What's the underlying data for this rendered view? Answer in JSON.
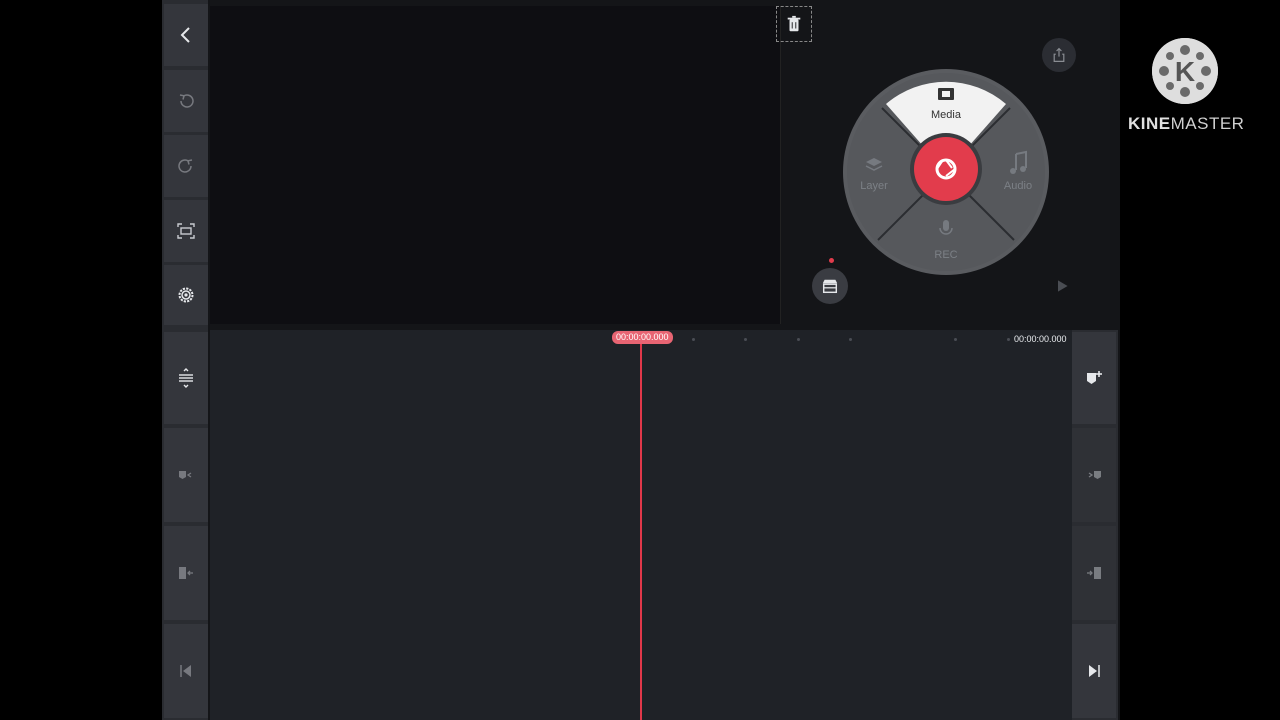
{
  "wheel": {
    "media_label": "Media",
    "layer_label": "Layer",
    "audio_label": "Audio",
    "rec_label": "REC"
  },
  "timeline": {
    "current_time": "00:00:00.000",
    "total_time": "00:00:00.000"
  },
  "logo": {
    "text_bold": "KINE",
    "text_light": "MASTER"
  },
  "colors": {
    "accent": "#e23c4c",
    "panel": "#2a2c31",
    "background": "#141518"
  }
}
